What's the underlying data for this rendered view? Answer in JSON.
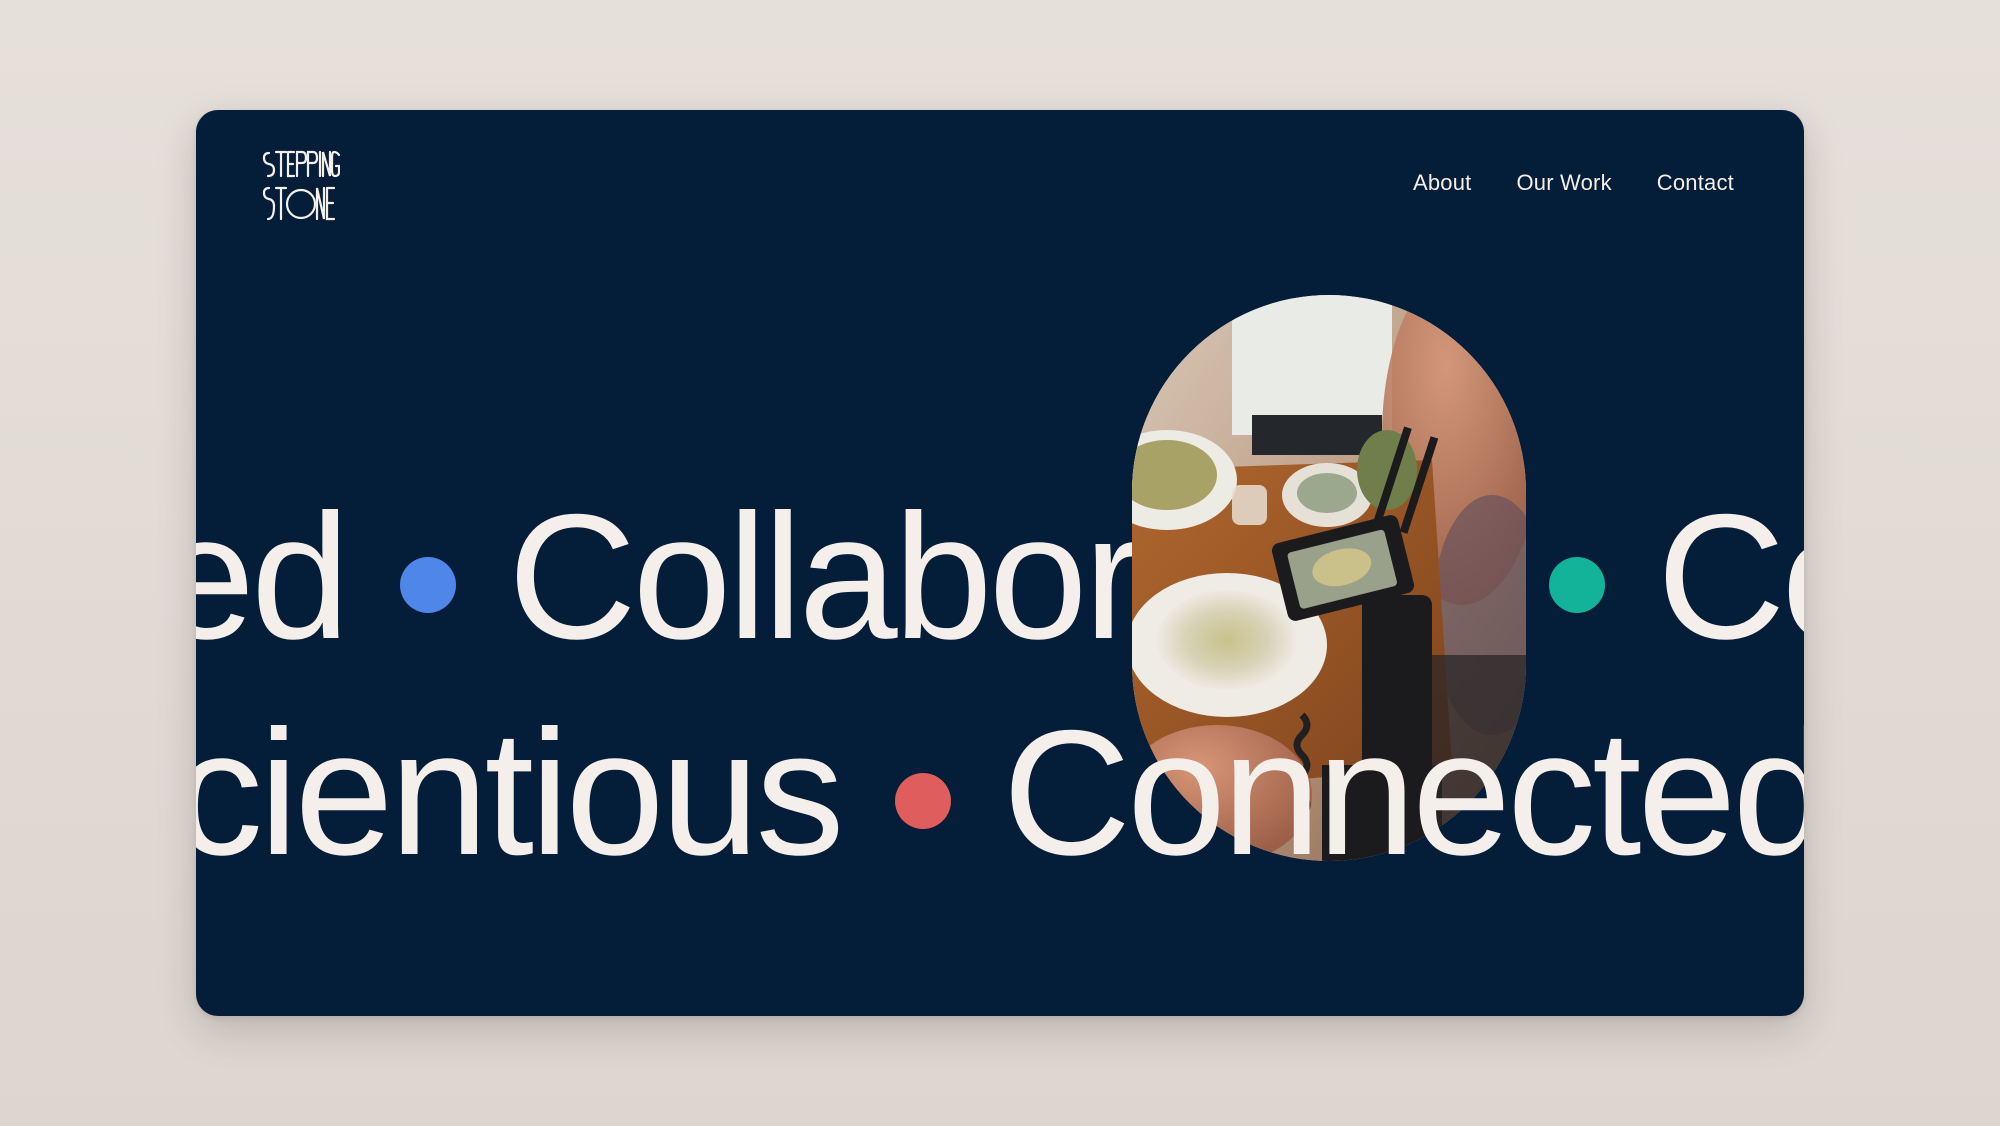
{
  "site": {
    "brand_name": "STEPPING STONE",
    "logo_icon": "stepping-stone-logo"
  },
  "nav": {
    "items": [
      {
        "label": "About"
      },
      {
        "label": "Our Work"
      },
      {
        "label": "Contact"
      }
    ]
  },
  "hero": {
    "row1": {
      "word_a": "ed",
      "word_b": "Collaborative",
      "word_c": "Co"
    },
    "row2": {
      "word_a": "cientious",
      "word_b": "Connected"
    },
    "colors": {
      "background": "#041d39",
      "text": "#f4efea",
      "dot_blue": "#4e87e7",
      "dot_teal": "#13b39a",
      "dot_red": "#e05d5d"
    },
    "photo_subject": "camera-filming-food-photo"
  }
}
